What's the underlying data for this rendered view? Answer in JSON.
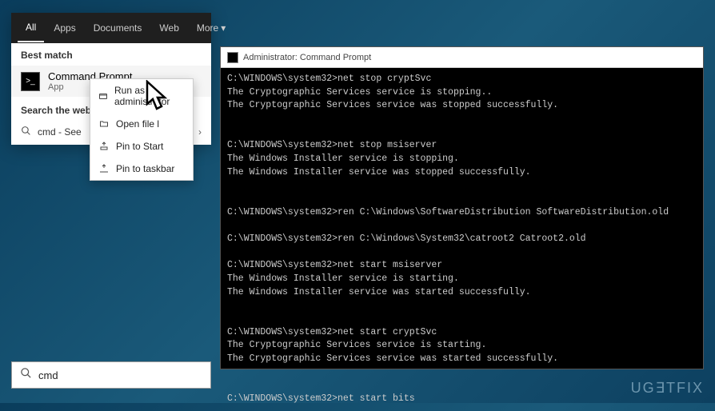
{
  "search": {
    "tabs": {
      "all": "All",
      "apps": "Apps",
      "documents": "Documents",
      "web": "Web",
      "more": "More"
    },
    "best_match_label": "Best match",
    "result": {
      "title": "Command Prompt",
      "subtitle": "App"
    },
    "search_web_label": "Search the web",
    "web_result": "cmd - See",
    "input_value": "cmd"
  },
  "context_menu": {
    "run_admin": "Run as administrator",
    "open_file": "Open file l",
    "pin_start": "Pin to Start",
    "pin_taskbar": "Pin to taskbar"
  },
  "cmd": {
    "title": "Administrator: Command Prompt",
    "lines": [
      "C:\\WINDOWS\\system32>net stop cryptSvc",
      "The Cryptographic Services service is stopping..",
      "The Cryptographic Services service was stopped successfully.",
      "",
      "",
      "C:\\WINDOWS\\system32>net stop msiserver",
      "The Windows Installer service is stopping.",
      "The Windows Installer service was stopped successfully.",
      "",
      "",
      "C:\\WINDOWS\\system32>ren C:\\Windows\\SoftwareDistribution SoftwareDistribution.old",
      "",
      "C:\\WINDOWS\\system32>ren C:\\Windows\\System32\\catroot2 Catroot2.old",
      "",
      "C:\\WINDOWS\\system32>net start msiserver",
      "The Windows Installer service is starting.",
      "The Windows Installer service was started successfully.",
      "",
      "",
      "C:\\WINDOWS\\system32>net start cryptSvc",
      "The Cryptographic Services service is starting.",
      "The Cryptographic Services service was started successfully.",
      "",
      "",
      "C:\\WINDOWS\\system32>net start bits"
    ]
  },
  "watermark": "UG∃TFIX"
}
